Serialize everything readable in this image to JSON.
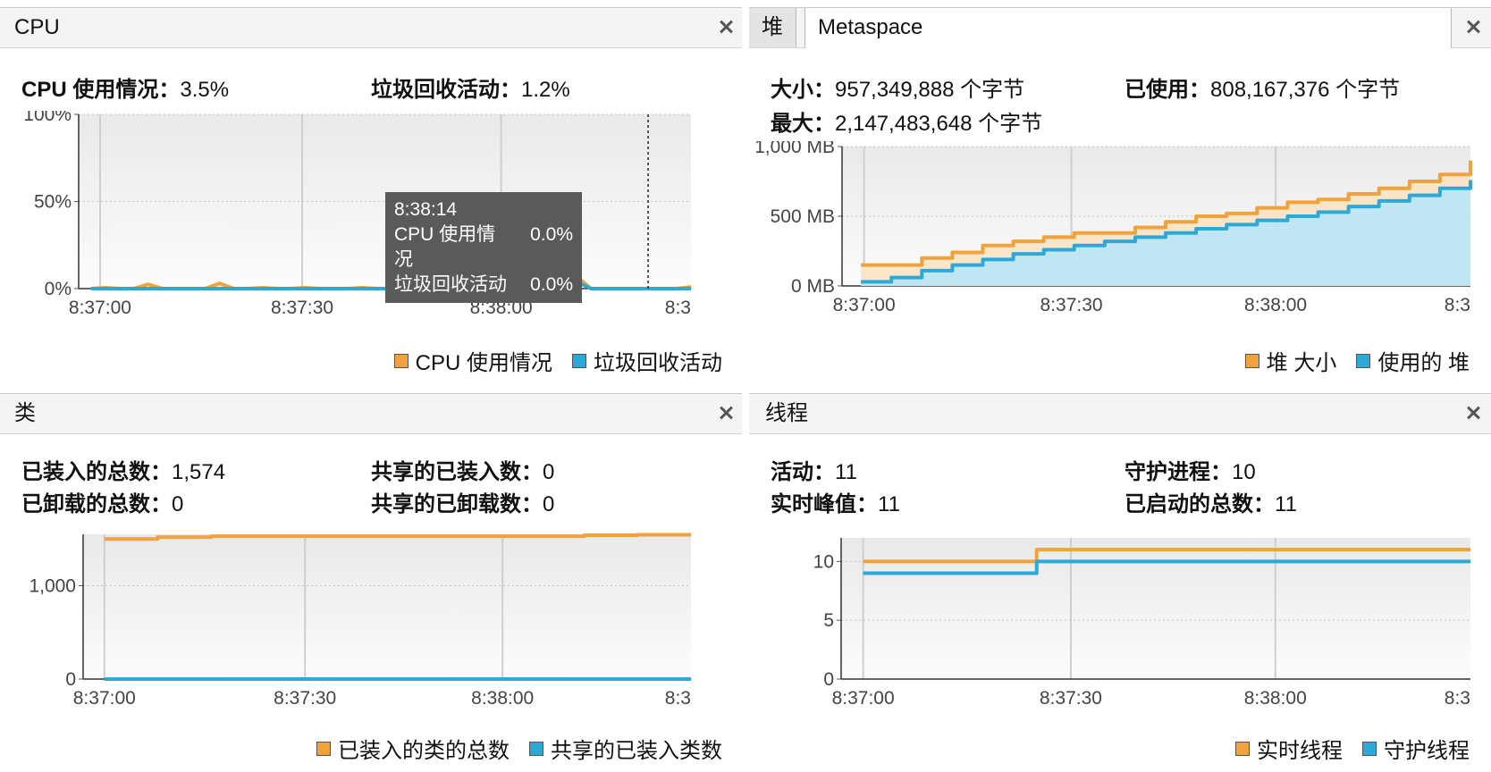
{
  "colors": {
    "orange": "#f0a23c",
    "blue": "#2da9d8",
    "orange_fill": "#fbe3c4",
    "blue_fill": "#b8e6f6"
  },
  "cpu": {
    "title": "CPU",
    "usage_label": "CPU 使用情况：",
    "usage_value": "3.5%",
    "gc_label": "垃圾回收活动：",
    "gc_value": "1.2%",
    "tooltip": {
      "time": "8:38:14",
      "cpu_label": "CPU 使用情况",
      "cpu_value": "0.0%",
      "gc_label": "垃圾回收活动",
      "gc_value": "0.0%"
    },
    "legend": [
      "CPU 使用情况",
      "垃圾回收活动"
    ]
  },
  "memory": {
    "tabs": [
      "堆",
      "Metaspace"
    ],
    "size_label": "大小：",
    "size_value": "957,349,888 个字节",
    "used_label": "已使用：",
    "used_value": "808,167,376 个字节",
    "max_label": "最大：",
    "max_value": "2,147,483,648 个字节",
    "legend": [
      "堆 大小",
      "使用的 堆"
    ]
  },
  "classes": {
    "title": "类",
    "loaded_label": "已装入的总数：",
    "loaded_value": "1,574",
    "unloaded_label": "已卸载的总数：",
    "unloaded_value": "0",
    "shared_loaded_label": "共享的已装入数：",
    "shared_loaded_value": "0",
    "shared_unloaded_label": "共享的已卸载数：",
    "shared_unloaded_value": "0",
    "legend": [
      "已装入的类的总数",
      "共享的已装入类数"
    ]
  },
  "threads": {
    "title": "线程",
    "live_label": "活动：",
    "live_value": "11",
    "peak_label": "实时峰值：",
    "peak_value": "11",
    "daemon_label": "守护进程：",
    "daemon_value": "10",
    "started_label": "已启动的总数：",
    "started_value": "11",
    "legend": [
      "实时线程",
      "守护线程"
    ]
  },
  "chart_data": [
    {
      "id": "cpu",
      "type": "line",
      "x_ticks": [
        "8:37:00",
        "8:37:30",
        "8:38:00",
        "8:3"
      ],
      "y_ticks": [
        "0%",
        "50%",
        "100%"
      ],
      "ylim": [
        0,
        100
      ],
      "series": [
        {
          "name": "CPU 使用情况",
          "values": [
            0,
            0.5,
            0,
            0,
            2.5,
            0,
            0,
            0,
            0,
            3,
            0,
            0,
            0.5,
            0,
            0,
            0.5,
            0,
            0,
            0,
            0.5,
            0,
            0,
            0.5,
            0,
            0,
            1,
            0,
            0.5,
            0,
            0.5,
            0,
            0,
            0,
            0,
            7,
            0,
            0,
            0,
            0,
            0,
            0,
            0,
            1
          ]
        },
        {
          "name": "垃圾回收活动",
          "values": [
            0,
            0,
            0,
            0,
            0,
            0,
            0,
            0,
            0,
            0,
            0,
            0,
            0,
            0,
            0,
            0,
            0,
            0,
            0,
            0,
            0,
            0,
            0,
            0,
            0,
            0,
            0,
            0,
            0,
            0,
            0,
            0,
            0,
            0,
            4,
            0,
            0,
            0,
            0,
            0,
            0,
            0,
            0
          ]
        }
      ]
    },
    {
      "id": "heap",
      "type": "area",
      "x_ticks": [
        "8:37:00",
        "8:37:30",
        "8:38:00",
        "8:3"
      ],
      "y_ticks": [
        "0 MB",
        "500 MB",
        "1,000 MB"
      ],
      "ylim": [
        0,
        1000
      ],
      "series": [
        {
          "name": "堆 大小",
          "values": [
            150,
            150,
            200,
            240,
            290,
            320,
            350,
            380,
            380,
            420,
            460,
            500,
            520,
            560,
            600,
            620,
            660,
            700,
            750,
            800,
            900
          ]
        },
        {
          "name": "使用的 堆",
          "values": [
            30,
            60,
            110,
            150,
            190,
            230,
            260,
            290,
            320,
            350,
            380,
            410,
            440,
            470,
            500,
            530,
            570,
            610,
            650,
            700,
            760
          ]
        }
      ]
    },
    {
      "id": "classes",
      "type": "line",
      "x_ticks": [
        "8:37:00",
        "8:37:30",
        "8:38:00",
        "8:3"
      ],
      "y_ticks": [
        "0",
        "1,000"
      ],
      "ylim": [
        0,
        1550
      ],
      "series": [
        {
          "name": "已装入的类的总数",
          "values": [
            1500,
            1520,
            1530,
            1530,
            1530,
            1530,
            1530,
            1530,
            1530,
            1540,
            1545,
            1545
          ]
        },
        {
          "name": "共享的已装入类数",
          "values": [
            0,
            0,
            0,
            0,
            0,
            0,
            0,
            0,
            0,
            0,
            0,
            0
          ]
        }
      ]
    },
    {
      "id": "threads",
      "type": "line",
      "x_ticks": [
        "8:37:00",
        "8:37:30",
        "8:38:00",
        "8:3"
      ],
      "y_ticks": [
        "0",
        "5",
        "10"
      ],
      "ylim": [
        0,
        12
      ],
      "series": [
        {
          "name": "实时线程",
          "values": [
            10,
            10,
            11,
            11,
            11,
            11,
            11,
            11
          ]
        },
        {
          "name": "守护线程",
          "values": [
            9,
            9,
            10,
            10,
            10,
            10,
            10,
            10
          ]
        }
      ]
    }
  ]
}
